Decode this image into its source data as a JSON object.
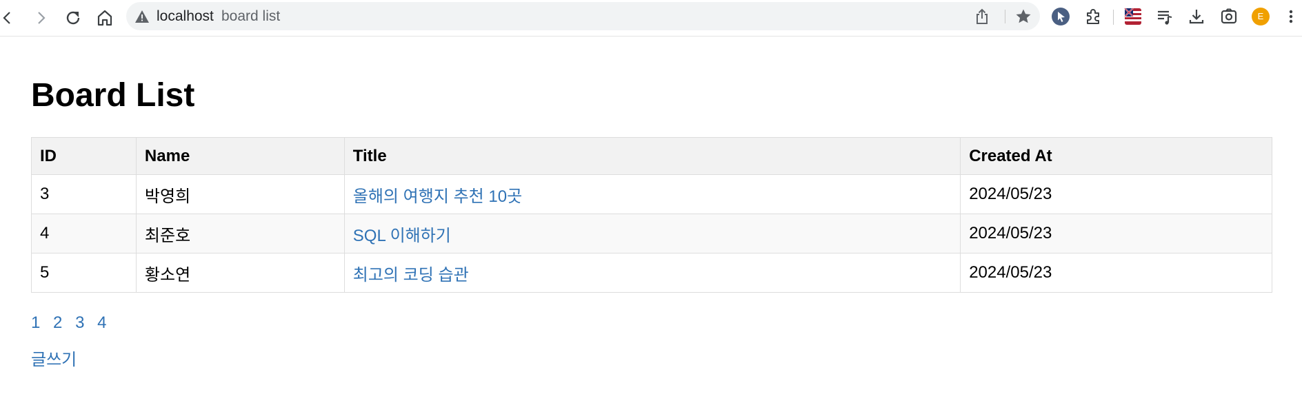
{
  "browser": {
    "host": "localhost",
    "path": "board list"
  },
  "page": {
    "title": "Board List",
    "columns": [
      "ID",
      "Name",
      "Title",
      "Created At"
    ],
    "rows": [
      {
        "id": "3",
        "name": "박영희",
        "title": "올해의 여행지 추천 10곳",
        "created_at": "2024/05/23"
      },
      {
        "id": "4",
        "name": "최준호",
        "title": "SQL 이해하기",
        "created_at": "2024/05/23"
      },
      {
        "id": "5",
        "name": "황소연",
        "title": "최고의 코딩 습관",
        "created_at": "2024/05/23"
      }
    ],
    "pages": [
      "1",
      "2",
      "3",
      "4"
    ],
    "write_label": "글쓰기"
  },
  "colors": {
    "link": "#2f72b5",
    "header_bg": "#f2f2f2",
    "avatar": "#f0a000"
  },
  "icons": [
    "back-icon",
    "forward-icon",
    "reload-icon",
    "home-icon",
    "warning-icon",
    "share-icon",
    "star-icon",
    "cursor-extension-icon",
    "puzzle-icon",
    "flag-extension-icon",
    "playlist-icon",
    "download-icon",
    "screenshot-icon",
    "avatar",
    "menu-icon"
  ],
  "profile_initial": "E"
}
